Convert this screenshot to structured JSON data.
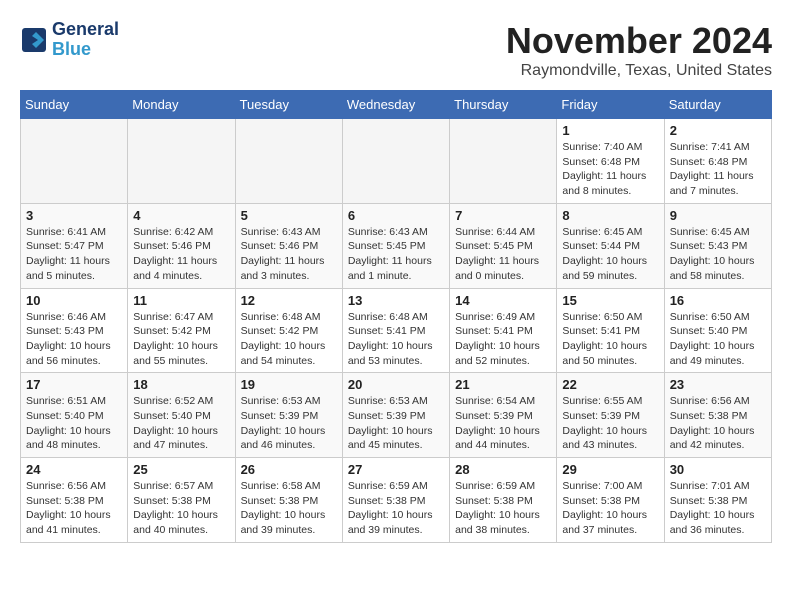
{
  "header": {
    "logo_line1": "General",
    "logo_line2": "Blue",
    "month": "November 2024",
    "location": "Raymondville, Texas, United States"
  },
  "weekdays": [
    "Sunday",
    "Monday",
    "Tuesday",
    "Wednesday",
    "Thursday",
    "Friday",
    "Saturday"
  ],
  "weeks": [
    [
      {
        "day": "",
        "info": ""
      },
      {
        "day": "",
        "info": ""
      },
      {
        "day": "",
        "info": ""
      },
      {
        "day": "",
        "info": ""
      },
      {
        "day": "",
        "info": ""
      },
      {
        "day": "1",
        "info": "Sunrise: 7:40 AM\nSunset: 6:48 PM\nDaylight: 11 hours and 8 minutes."
      },
      {
        "day": "2",
        "info": "Sunrise: 7:41 AM\nSunset: 6:48 PM\nDaylight: 11 hours and 7 minutes."
      }
    ],
    [
      {
        "day": "3",
        "info": "Sunrise: 6:41 AM\nSunset: 5:47 PM\nDaylight: 11 hours and 5 minutes."
      },
      {
        "day": "4",
        "info": "Sunrise: 6:42 AM\nSunset: 5:46 PM\nDaylight: 11 hours and 4 minutes."
      },
      {
        "day": "5",
        "info": "Sunrise: 6:43 AM\nSunset: 5:46 PM\nDaylight: 11 hours and 3 minutes."
      },
      {
        "day": "6",
        "info": "Sunrise: 6:43 AM\nSunset: 5:45 PM\nDaylight: 11 hours and 1 minute."
      },
      {
        "day": "7",
        "info": "Sunrise: 6:44 AM\nSunset: 5:45 PM\nDaylight: 11 hours and 0 minutes."
      },
      {
        "day": "8",
        "info": "Sunrise: 6:45 AM\nSunset: 5:44 PM\nDaylight: 10 hours and 59 minutes."
      },
      {
        "day": "9",
        "info": "Sunrise: 6:45 AM\nSunset: 5:43 PM\nDaylight: 10 hours and 58 minutes."
      }
    ],
    [
      {
        "day": "10",
        "info": "Sunrise: 6:46 AM\nSunset: 5:43 PM\nDaylight: 10 hours and 56 minutes."
      },
      {
        "day": "11",
        "info": "Sunrise: 6:47 AM\nSunset: 5:42 PM\nDaylight: 10 hours and 55 minutes."
      },
      {
        "day": "12",
        "info": "Sunrise: 6:48 AM\nSunset: 5:42 PM\nDaylight: 10 hours and 54 minutes."
      },
      {
        "day": "13",
        "info": "Sunrise: 6:48 AM\nSunset: 5:41 PM\nDaylight: 10 hours and 53 minutes."
      },
      {
        "day": "14",
        "info": "Sunrise: 6:49 AM\nSunset: 5:41 PM\nDaylight: 10 hours and 52 minutes."
      },
      {
        "day": "15",
        "info": "Sunrise: 6:50 AM\nSunset: 5:41 PM\nDaylight: 10 hours and 50 minutes."
      },
      {
        "day": "16",
        "info": "Sunrise: 6:50 AM\nSunset: 5:40 PM\nDaylight: 10 hours and 49 minutes."
      }
    ],
    [
      {
        "day": "17",
        "info": "Sunrise: 6:51 AM\nSunset: 5:40 PM\nDaylight: 10 hours and 48 minutes."
      },
      {
        "day": "18",
        "info": "Sunrise: 6:52 AM\nSunset: 5:40 PM\nDaylight: 10 hours and 47 minutes."
      },
      {
        "day": "19",
        "info": "Sunrise: 6:53 AM\nSunset: 5:39 PM\nDaylight: 10 hours and 46 minutes."
      },
      {
        "day": "20",
        "info": "Sunrise: 6:53 AM\nSunset: 5:39 PM\nDaylight: 10 hours and 45 minutes."
      },
      {
        "day": "21",
        "info": "Sunrise: 6:54 AM\nSunset: 5:39 PM\nDaylight: 10 hours and 44 minutes."
      },
      {
        "day": "22",
        "info": "Sunrise: 6:55 AM\nSunset: 5:39 PM\nDaylight: 10 hours and 43 minutes."
      },
      {
        "day": "23",
        "info": "Sunrise: 6:56 AM\nSunset: 5:38 PM\nDaylight: 10 hours and 42 minutes."
      }
    ],
    [
      {
        "day": "24",
        "info": "Sunrise: 6:56 AM\nSunset: 5:38 PM\nDaylight: 10 hours and 41 minutes."
      },
      {
        "day": "25",
        "info": "Sunrise: 6:57 AM\nSunset: 5:38 PM\nDaylight: 10 hours and 40 minutes."
      },
      {
        "day": "26",
        "info": "Sunrise: 6:58 AM\nSunset: 5:38 PM\nDaylight: 10 hours and 39 minutes."
      },
      {
        "day": "27",
        "info": "Sunrise: 6:59 AM\nSunset: 5:38 PM\nDaylight: 10 hours and 39 minutes."
      },
      {
        "day": "28",
        "info": "Sunrise: 6:59 AM\nSunset: 5:38 PM\nDaylight: 10 hours and 38 minutes."
      },
      {
        "day": "29",
        "info": "Sunrise: 7:00 AM\nSunset: 5:38 PM\nDaylight: 10 hours and 37 minutes."
      },
      {
        "day": "30",
        "info": "Sunrise: 7:01 AM\nSunset: 5:38 PM\nDaylight: 10 hours and 36 minutes."
      }
    ]
  ]
}
